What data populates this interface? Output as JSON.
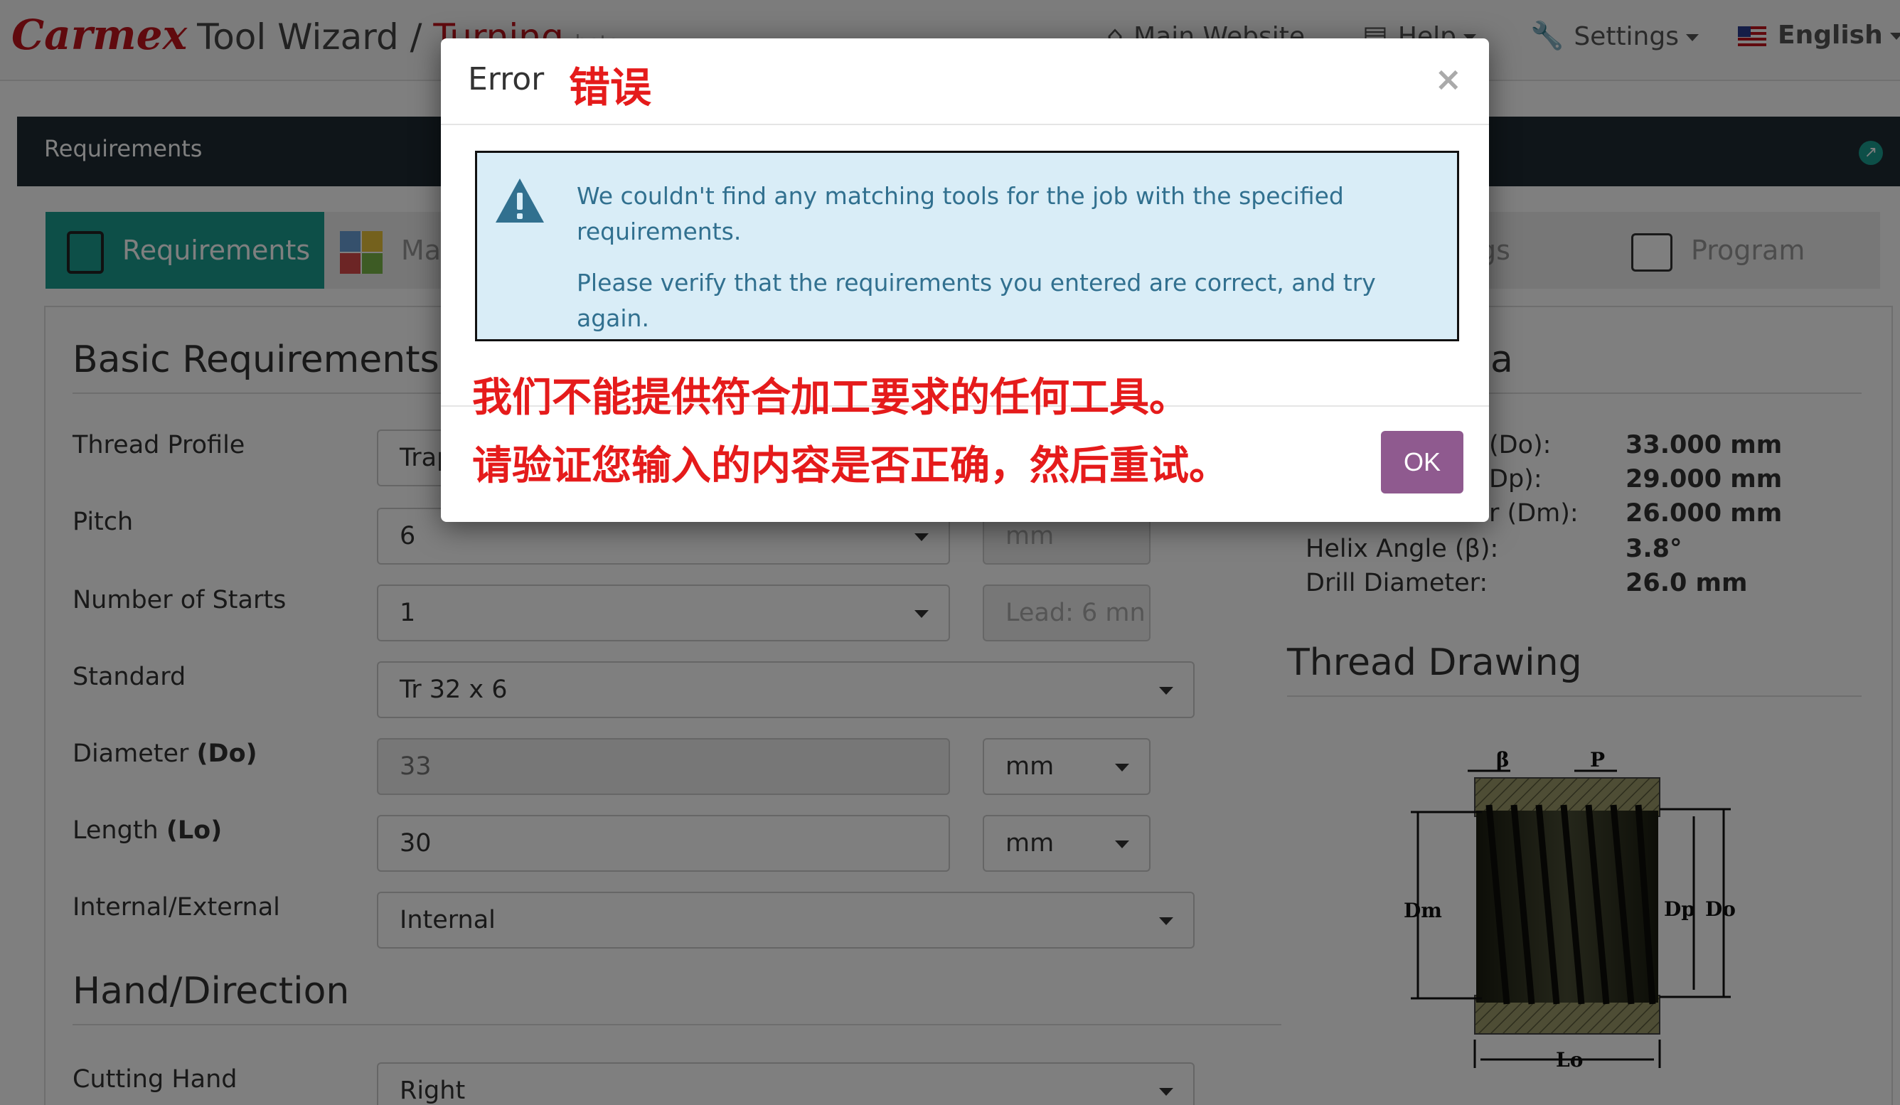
{
  "navbar": {
    "brand_logo": "Carmex",
    "brand_tool": "Tool Wizard /",
    "brand_turning": "Turning",
    "brand_beta": "beta",
    "main_website": "Main Website",
    "help": "Help",
    "settings": "Settings",
    "language": "English"
  },
  "panel": {
    "title": "Requirements"
  },
  "tabs": [
    {
      "label": "Requirements",
      "icon": "clipboard-icon"
    },
    {
      "label": "Ma",
      "icon": "material-grid-icon"
    },
    {
      "label": "gs",
      "icon": ""
    },
    {
      "label": "Program",
      "icon": "program-icon"
    }
  ],
  "basic": {
    "heading": "Basic Requirements",
    "fields": {
      "thread_profile": {
        "label": "Thread Profile",
        "value": "Trap"
      },
      "pitch": {
        "label": "Pitch",
        "value": "6",
        "unit": "mm"
      },
      "starts": {
        "label": "Number of Starts",
        "value": "1",
        "lead": "Lead: 6 mn"
      },
      "standard": {
        "label": "Standard",
        "value": "Tr 32 x 6"
      },
      "diameter": {
        "label": "Diameter",
        "label_bold": "(Do)",
        "value": "33",
        "unit": "mm"
      },
      "length": {
        "label": "Length",
        "label_bold": "(Lo)",
        "value": "30",
        "unit": "mm"
      },
      "int_ext": {
        "label": "Internal/External",
        "value": "Internal"
      }
    }
  },
  "hand": {
    "heading": "Hand/Direction",
    "cutting_hand": {
      "label": "Cutting Hand",
      "value": "Right"
    }
  },
  "specs": {
    "heading_fragment": "a",
    "rows": [
      {
        "label": "(Do):",
        "value": "33.000 mm"
      },
      {
        "label": "Dp):",
        "value": "29.000 mm"
      },
      {
        "label": "Minor Diameter (Dm):",
        "value": "26.000 mm"
      },
      {
        "label": "Helix Angle (β):",
        "value": "3.8°"
      },
      {
        "label": "Drill Diameter:",
        "value": "26.0 mm"
      }
    ]
  },
  "drawing": {
    "heading": "Thread Drawing",
    "labels": {
      "beta": "β",
      "p": "P",
      "dm": "Dm",
      "dp": "Dp",
      "do": "Do",
      "lo": "Lo"
    }
  },
  "modal": {
    "title": "Error",
    "title_cn": "错误",
    "close": "×",
    "alert_line1": "We couldn't find any matching tools for the job with the specified requirements.",
    "alert_line2": "Please verify that the requirements you entered are correct, and try again.",
    "cn_line1": "我们不能提供符合加工要求的任何工具。",
    "cn_line2": "请验证您输入的内容是否正确，然后重试。",
    "ok": "OK"
  }
}
